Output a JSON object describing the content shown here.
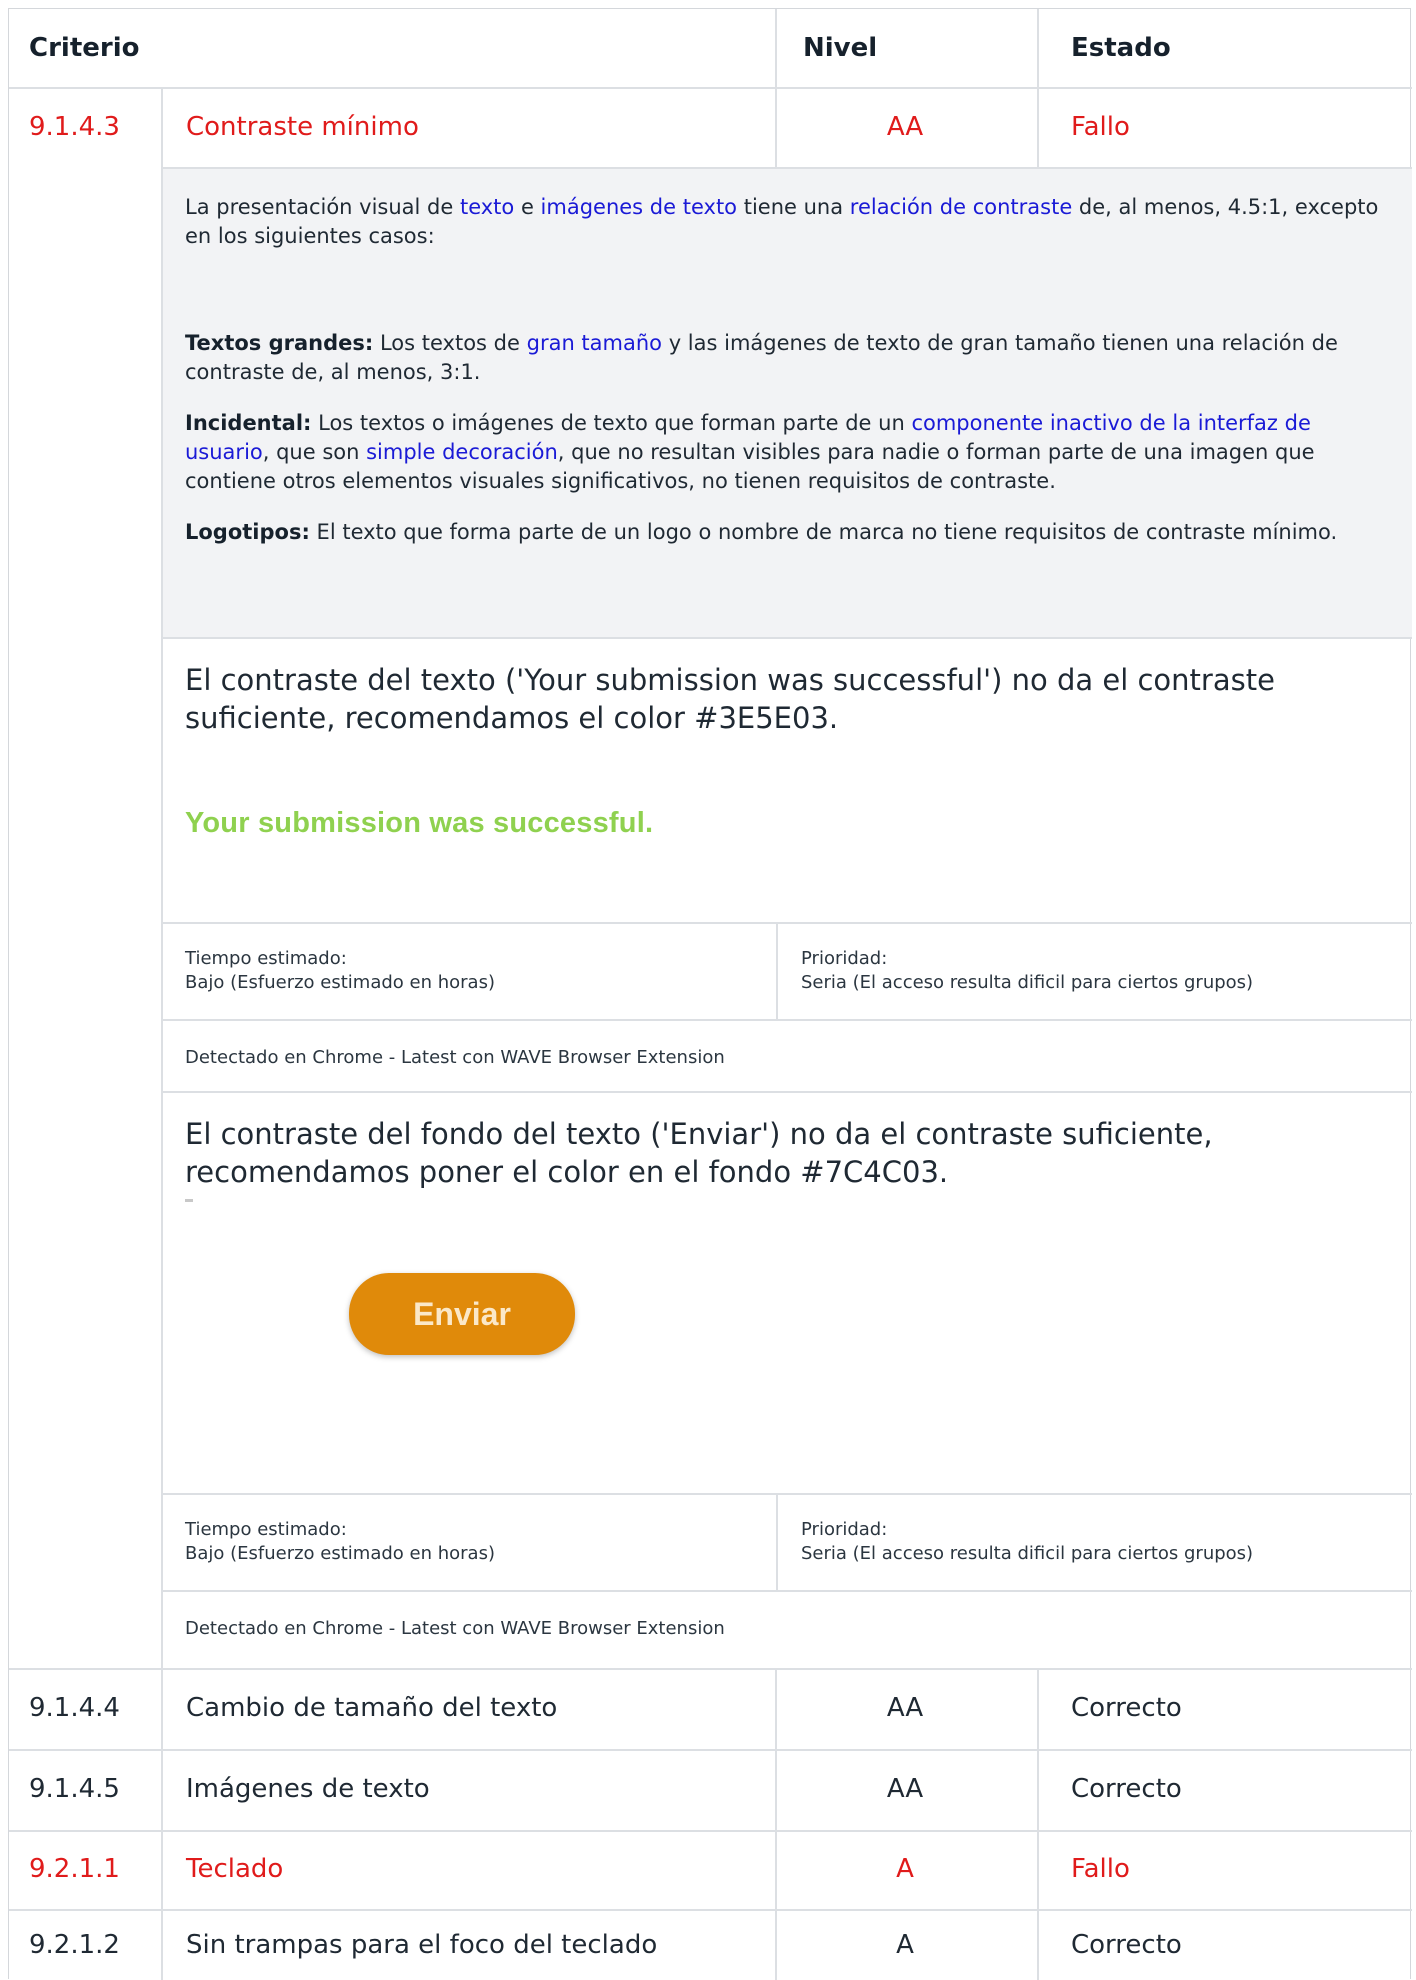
{
  "header": {
    "criterio": "Criterio",
    "nivel": "Nivel",
    "estado": "Estado"
  },
  "row1": {
    "id": "9.1.4.3",
    "name": "Contraste mínimo",
    "level": "AA",
    "status": "Fallo",
    "description": {
      "p1_a": "La presentación visual de ",
      "p1_link1": "texto",
      "p1_b": " e ",
      "p1_link2": "imágenes de texto",
      "p1_c": " tiene una ",
      "p1_link3": "relación de contraste",
      "p1_d": " de, al menos, 4.5:1, excepto en los siguientes casos:",
      "p2_title": "Textos grandes:",
      "p2_a": " Los textos de ",
      "p2_link": "gran tamaño",
      "p2_b": " y las imágenes de texto de gran tamaño tienen una relación de contraste de, al menos, 3:1.",
      "p3_title": "Incidental:",
      "p3_a": " Los textos o imágenes de texto que forman parte de un ",
      "p3_link1": "componente inactivo de la interfaz de usuario",
      "p3_b": ", que son ",
      "p3_link2": "simple decoración",
      "p3_c": ", que no resultan visibles para nadie o forman parte de una imagen que contiene otros elementos visuales significativos, no tienen requisitos de contraste.",
      "p4_title": "Logotipos:",
      "p4_a": " El texto que forma parte de un logo o nombre de marca no tiene requisitos de contraste mínimo."
    },
    "finding1": {
      "text": "El contraste del texto ('Your submission was successful') no da el contraste suficiente, recomendamos el color #3E5E03.",
      "screenshot_text": "Your submission was successful.",
      "time_label": "Tiempo estimado:",
      "time_value": "Bajo (Esfuerzo estimado en horas)",
      "priority_label": "Prioridad:",
      "priority_value": "Seria (El acceso resulta dificil para ciertos grupos)",
      "detected": "Detectado en Chrome - Latest con WAVE Browser Extension"
    },
    "finding2": {
      "text": "El contraste del fondo del texto ('Enviar') no da el contraste suficiente, recomendamos poner el color en el fondo #7C4C03.",
      "button_text": "Enviar",
      "time_label": "Tiempo estimado:",
      "time_value": "Bajo (Esfuerzo estimado en horas)",
      "priority_label": "Prioridad:",
      "priority_value": "Seria (El acceso resulta dificil para ciertos grupos)",
      "detected": "Detectado en Chrome - Latest con WAVE Browser Extension"
    }
  },
  "rows": [
    {
      "id": "9.1.4.4",
      "name": "Cambio de tamaño del texto",
      "level": "AA",
      "status": "Correcto"
    },
    {
      "id": "9.1.4.5",
      "name": "Imágenes de texto",
      "level": "AA",
      "status": "Correcto"
    },
    {
      "id": "9.2.1.1",
      "name": "Teclado",
      "level": "A",
      "status": "Fallo"
    },
    {
      "id": "9.2.1.2",
      "name": "Sin trampas para el foco del teclado",
      "level": "A",
      "status": "Correcto"
    }
  ],
  "colors": {
    "fail": "#e01b1b",
    "link": "#1a1ad6",
    "description_bg": "#f2f3f5",
    "screenshot_green": "#8fd14f",
    "button_orange": "#e08a0a"
  }
}
